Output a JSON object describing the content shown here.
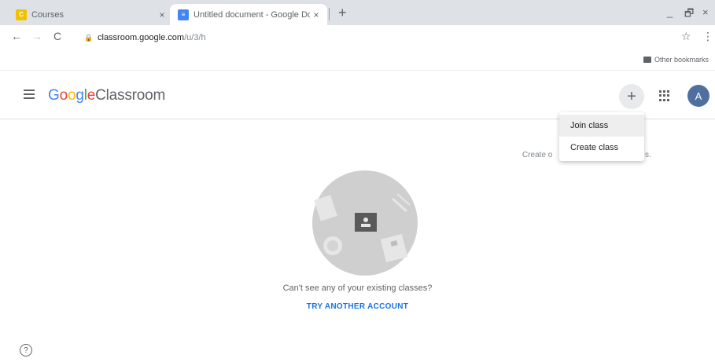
{
  "browser": {
    "tabs": [
      {
        "title": "Courses",
        "close": "×",
        "favicon_color": "#f2c200"
      },
      {
        "title": "Untitled document - Google Docs",
        "close": "×",
        "favicon_color": "#4285f4"
      }
    ],
    "new_tab": "+",
    "window_controls": {
      "minimize": "_",
      "restore": "🗗",
      "close": "×"
    },
    "nav": {
      "back": "←",
      "forward": "→",
      "reload": "C"
    },
    "url": {
      "host": "classroom.google.com",
      "path": "/u/3/h"
    },
    "bookmarks": {
      "other": "Other bookmarks"
    }
  },
  "app": {
    "logo": {
      "google": [
        "G",
        "o",
        "o",
        "g",
        "l",
        "e"
      ],
      "product": "Classroom"
    },
    "plus": "+",
    "avatar_letter": "A",
    "menu": {
      "join": "Join class",
      "create": "Create class"
    },
    "behind_text": "Create o",
    "behind_dot": "s.",
    "empty_message": "Can't see any of your existing classes?",
    "try_account": "TRY ANOTHER ACCOUNT",
    "help": "?"
  },
  "colors": {
    "accent": "#1a73e8",
    "avatar": "#4f6f9f"
  }
}
